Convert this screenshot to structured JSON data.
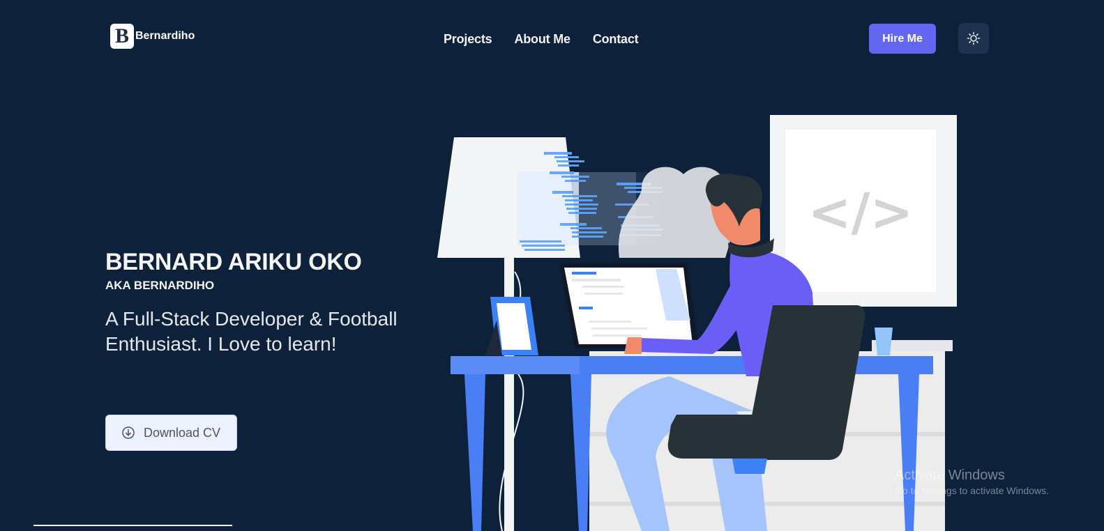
{
  "brand": {
    "logo_letter": "B",
    "name": "Bernardiho"
  },
  "nav": {
    "items": [
      "Projects",
      "About Me",
      "Contact"
    ]
  },
  "header": {
    "hire_label": "Hire Me",
    "theme_toggle_icon": "sun-icon"
  },
  "hero": {
    "name": "BERNARD ARIKU OKO",
    "aka": "AKA BERNARDIHO",
    "tagline": "A Full-Stack Developer & Football Enthusiast. I Love to learn!",
    "download_label": "Download CV",
    "download_icon": "download-circle-icon"
  },
  "illustration": {
    "monitor_code": "</>"
  },
  "overlay": {
    "activate_title": "Activate Windows",
    "activate_sub": "Go to Settings to activate Windows."
  },
  "colors": {
    "background": "#0e213a",
    "accent": "#6366f1",
    "desk": "#4a7ef5",
    "shirt": "#6a5ef6"
  }
}
